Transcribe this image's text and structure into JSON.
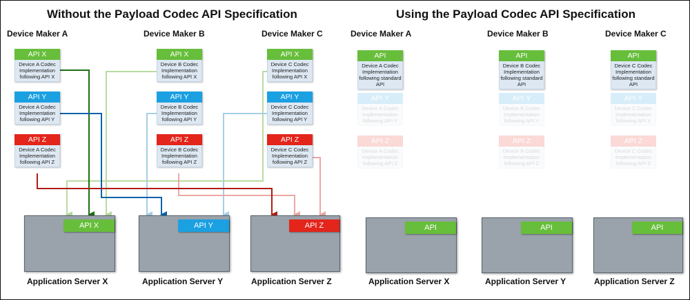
{
  "titles": {
    "left": "Without the Payload Codec API Specification",
    "right": "Using the Payload Codec API Specification"
  },
  "left": {
    "makers": [
      "Device Maker A",
      "Device Maker B",
      "Device Maker C"
    ],
    "codecs": {
      "a": [
        {
          "tab": "API X",
          "text": "Device A Codec Implementation following API X"
        },
        {
          "tab": "API Y",
          "text": "Device A Codec Implementation following API Y"
        },
        {
          "tab": "API Z",
          "text": "Device A Codec Implementation following API Z"
        }
      ],
      "b": [
        {
          "tab": "API X",
          "text": "Device B Codec Implementation following API X"
        },
        {
          "tab": "API Y",
          "text": "Device B Codec Implementation following API Y"
        },
        {
          "tab": "API Z",
          "text": "Device B Codec Implementation following API Z"
        }
      ],
      "c": [
        {
          "tab": "API X",
          "text": "Device C Codec Implementation following API X"
        },
        {
          "tab": "API Y",
          "text": "Device C Codec Implementation following API Y"
        },
        {
          "tab": "API Z",
          "text": "Device C Codec Implementation following API Z"
        }
      ]
    },
    "servers": [
      {
        "api": "API X",
        "label": "Application Server X"
      },
      {
        "api": "API Y",
        "label": "Application Server Y"
      },
      {
        "api": "API Z",
        "label": "Application Server Z"
      }
    ]
  },
  "right": {
    "makers": [
      "Device Maker A",
      "Device Maker B",
      "Device Maker C"
    ],
    "codecs": {
      "a": [
        {
          "tab": "API",
          "text": "Device A Codec Implementation following standard API"
        },
        {
          "tab": "API Y",
          "text": "Device A Codec Implementation following API Y"
        },
        {
          "tab": "API Z",
          "text": "Device A Codec Implementation following API Z"
        }
      ],
      "b": [
        {
          "tab": "API",
          "text": "Device B Codec Implementation following standard API"
        },
        {
          "tab": "API Y",
          "text": "Device B Codec Implementation following API Y"
        },
        {
          "tab": "API Z",
          "text": "Device B Codec Implementation following API Z"
        }
      ],
      "c": [
        {
          "tab": "API",
          "text": "Device C Codec Implementation following standard API"
        },
        {
          "tab": "API Y",
          "text": "Device C Codec Implementation following API Y"
        },
        {
          "tab": "API Z",
          "text": "Device C Codec Implementation following API Z"
        }
      ]
    },
    "servers": [
      {
        "api": "API",
        "label": "Application Server X"
      },
      {
        "api": "API",
        "label": "Application Server Y"
      },
      {
        "api": "API",
        "label": "Application Server Z"
      }
    ]
  },
  "colors": {
    "api_x": "#67be3b",
    "api_y": "#1ba0e2",
    "api_z": "#e3251b",
    "server_fill": "#9aa3ab",
    "codec_body": "#dde8f3",
    "wire_x_dark": "#1c6e10",
    "wire_y_dark": "#0a61ab",
    "wire_z_dark": "#b01c12",
    "wire_x_light": "#b8dba0",
    "wire_y_light": "#a4cfe6",
    "wire_z_light": "#eba8a2"
  }
}
